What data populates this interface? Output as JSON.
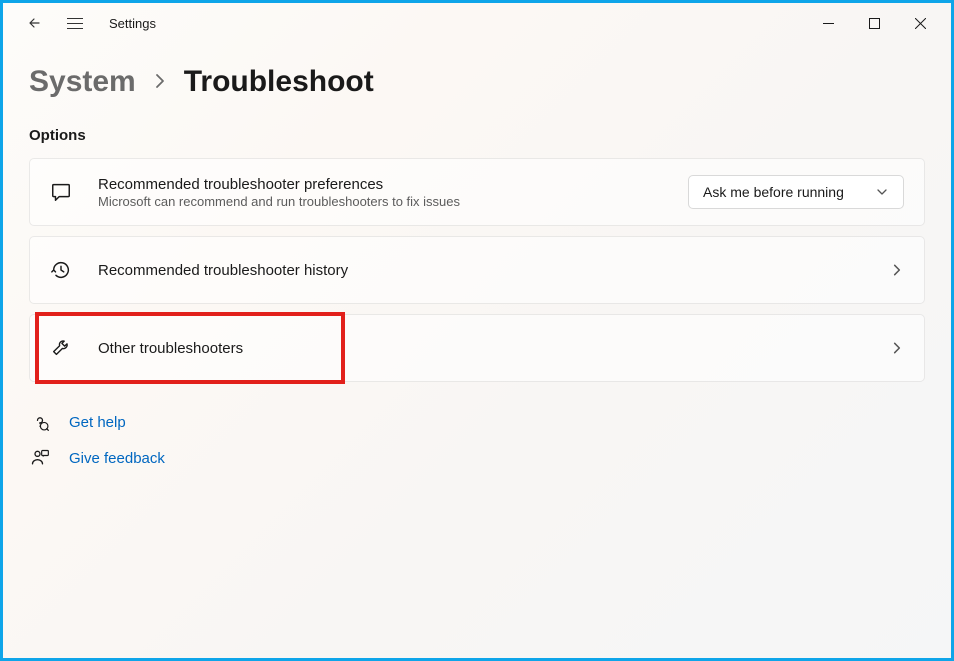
{
  "app": {
    "title": "Settings"
  },
  "breadcrumb": {
    "parent": "System",
    "current": "Troubleshoot"
  },
  "section": {
    "label": "Options"
  },
  "cards": {
    "recommended_prefs": {
      "title": "Recommended troubleshooter preferences",
      "subtitle": "Microsoft can recommend and run troubleshooters to fix issues",
      "dropdown_value": "Ask me before running"
    },
    "history": {
      "title": "Recommended troubleshooter history"
    },
    "other": {
      "title": "Other troubleshooters"
    }
  },
  "footer": {
    "help": "Get help",
    "feedback": "Give feedback"
  }
}
